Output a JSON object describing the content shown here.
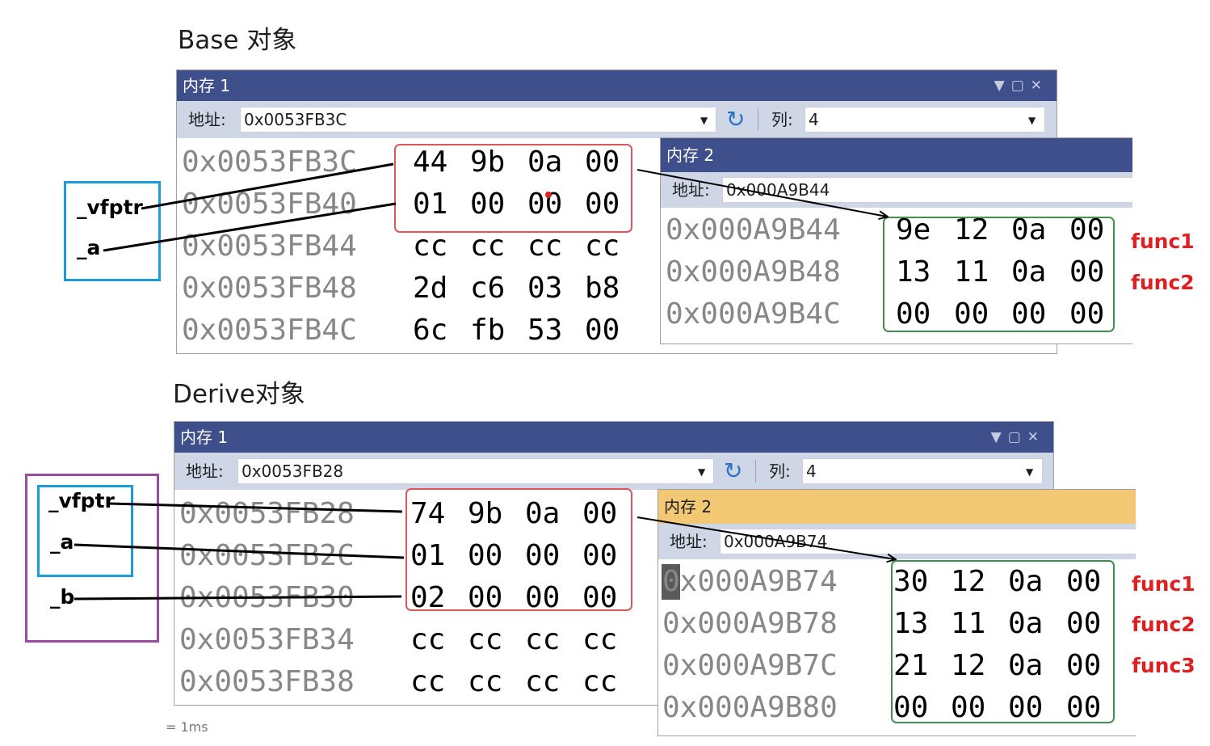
{
  "base": {
    "heading": "Base 对象",
    "mem1": {
      "title": "内存 1",
      "addr_label": "地址:",
      "addr_value": "0x0053FB3C",
      "col_label": "列:",
      "col_value": "4",
      "rows": [
        {
          "addr": "0x0053FB3C",
          "bytes": [
            "44",
            "9b",
            "0a",
            "00"
          ]
        },
        {
          "addr": "0x0053FB40",
          "bytes": [
            "01",
            "00",
            "00",
            "00"
          ]
        },
        {
          "addr": "0x0053FB44",
          "bytes": [
            "cc",
            "cc",
            "cc",
            "cc"
          ]
        },
        {
          "addr": "0x0053FB48",
          "bytes": [
            "2d",
            "c6",
            "03",
            "b8"
          ]
        },
        {
          "addr": "0x0053FB4C",
          "bytes": [
            "6c",
            "fb",
            "53",
            "00"
          ]
        }
      ]
    },
    "mem2": {
      "title": "内存 2",
      "addr_label": "地址:",
      "addr_value": "0x000A9B44",
      "rows": [
        {
          "addr": "0x000A9B44",
          "bytes": [
            "9e",
            "12",
            "0a",
            "00"
          ]
        },
        {
          "addr": "0x000A9B48",
          "bytes": [
            "13",
            "11",
            "0a",
            "00"
          ]
        },
        {
          "addr": "0x000A9B4C",
          "bytes": [
            "00",
            "00",
            "00",
            "00"
          ]
        }
      ]
    },
    "fields": [
      "_vfptr",
      "_a"
    ],
    "funcs": [
      "func1",
      "func2"
    ]
  },
  "derive": {
    "heading": "Derive对象",
    "mem1": {
      "title": "内存 1",
      "addr_label": "地址:",
      "addr_value": "0x0053FB28",
      "col_label": "列:",
      "col_value": "4",
      "rows": [
        {
          "addr": "0x0053FB28",
          "bytes": [
            "74",
            "9b",
            "0a",
            "00"
          ]
        },
        {
          "addr": "0x0053FB2C",
          "bytes": [
            "01",
            "00",
            "00",
            "00"
          ]
        },
        {
          "addr": "0x0053FB30",
          "bytes": [
            "02",
            "00",
            "00",
            "00"
          ]
        },
        {
          "addr": "0x0053FB34",
          "bytes": [
            "cc",
            "cc",
            "cc",
            "cc"
          ]
        },
        {
          "addr": "0x0053FB38",
          "bytes": [
            "cc",
            "cc",
            "cc",
            "cc"
          ]
        }
      ]
    },
    "mem2": {
      "title": "内存 2",
      "addr_label": "地址:",
      "addr_value": "0x000A9B74",
      "rows": [
        {
          "addr": "0x000A9B74",
          "bytes": [
            "30",
            "12",
            "0a",
            "00"
          ]
        },
        {
          "addr": "0x000A9B78",
          "bytes": [
            "13",
            "11",
            "0a",
            "00"
          ]
        },
        {
          "addr": "0x000A9B7C",
          "bytes": [
            "21",
            "12",
            "0a",
            "00"
          ]
        },
        {
          "addr": "0x000A9B80",
          "bytes": [
            "00",
            "00",
            "00",
            "00"
          ]
        }
      ]
    },
    "fields": [
      "_vfptr",
      "_a",
      "_b"
    ],
    "funcs": [
      "func1",
      "func2",
      "func3"
    ]
  },
  "footer": "= 1ms",
  "colors": {
    "titlebar": "#3e4f8c",
    "titlebar_active": "#f3c874",
    "addrbar": "#cfd6e5",
    "address_text": "#878787",
    "red_box": "#d9585d",
    "green_box": "#3f8f4e",
    "blue_box": "#1a9cd8",
    "purple_box": "#9b4aa4",
    "func_label": "#e02020"
  }
}
